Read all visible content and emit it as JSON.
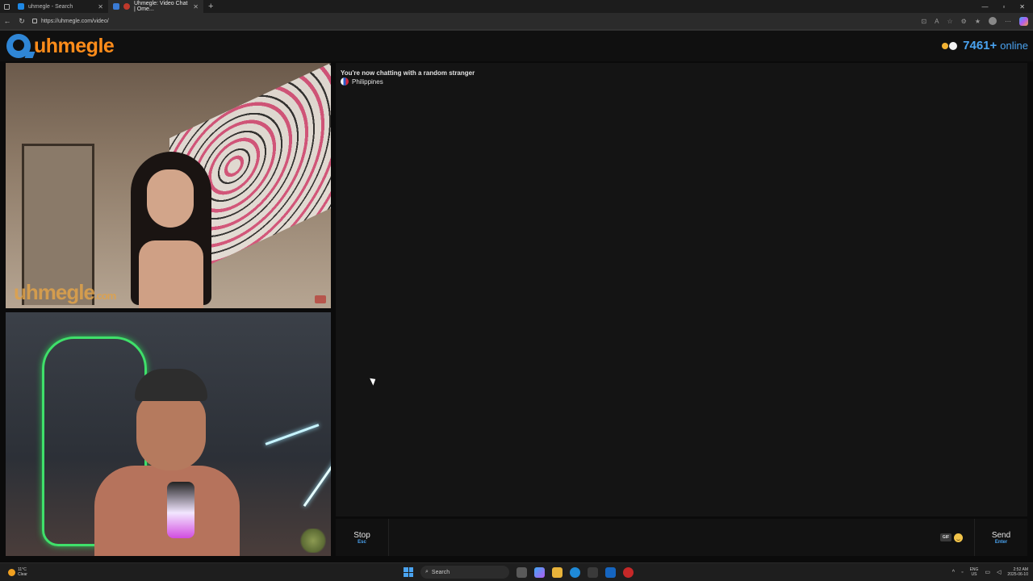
{
  "browser": {
    "tabs": [
      {
        "title": "uhmegle - Search",
        "active": false
      },
      {
        "title": "Uhmegle: Video Chat | Ome...",
        "active": true
      }
    ],
    "new_tab": "+",
    "url": "https://uhmegle.com/video/",
    "window_controls": [
      "—",
      "▫",
      "✕"
    ]
  },
  "header": {
    "logo_text": "uhmegle",
    "online_count": "7461+",
    "online_label": "online",
    "colors": {
      "logo": "#ff8c1a",
      "accent": "#4aa3f0"
    }
  },
  "videos": {
    "stranger_watermark": "uhmegle",
    "stranger_watermark_suffix": ".com"
  },
  "chat": {
    "status": "You're now chatting with a random stranger",
    "country": "Philippines",
    "message_placeholder": ""
  },
  "controls": {
    "stop_label": "Stop",
    "stop_shortcut": "Esc",
    "gif_label": "GIF",
    "send_label": "Send",
    "send_shortcut": "Enter"
  },
  "taskbar": {
    "weather_temp": "11°C",
    "weather_desc": "Clear",
    "search_label": "Search",
    "lang": "ENG",
    "region": "US",
    "time": "2:52 AM",
    "date": "2025-06-10"
  }
}
